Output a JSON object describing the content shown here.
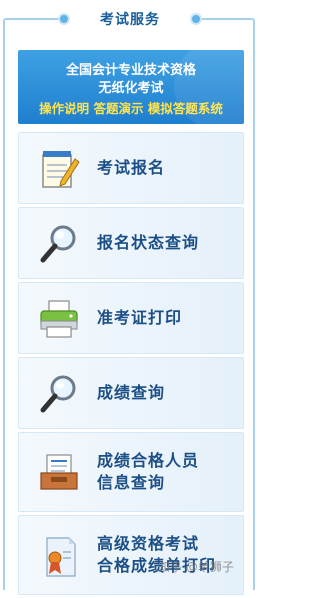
{
  "header": {
    "title": "考试服务"
  },
  "banner": {
    "line1": "全国会计专业技术资格",
    "line2": "无纸化考试",
    "line3": "操作说明 答题演示 模拟答题系统"
  },
  "menu": [
    {
      "label": "考试报名",
      "icon": "notepad-pencil-icon"
    },
    {
      "label": "报名状态查询",
      "icon": "magnifier-icon"
    },
    {
      "label": "准考证打印",
      "icon": "printer-icon"
    },
    {
      "label": "成绩查询",
      "icon": "magnifier-icon"
    },
    {
      "label_line1": "成绩合格人员",
      "label_line2": "信息查询",
      "icon": "document-tray-icon"
    },
    {
      "label_line1": "高级资格考试",
      "label_line2": "合格成绩单打印",
      "icon": "certificate-icon"
    }
  ],
  "watermark": "知乎 @单狮子",
  "colors": {
    "accent": "#1c4f86",
    "banner": "#2b8fd9",
    "banner_highlight": "#ffe34a"
  }
}
